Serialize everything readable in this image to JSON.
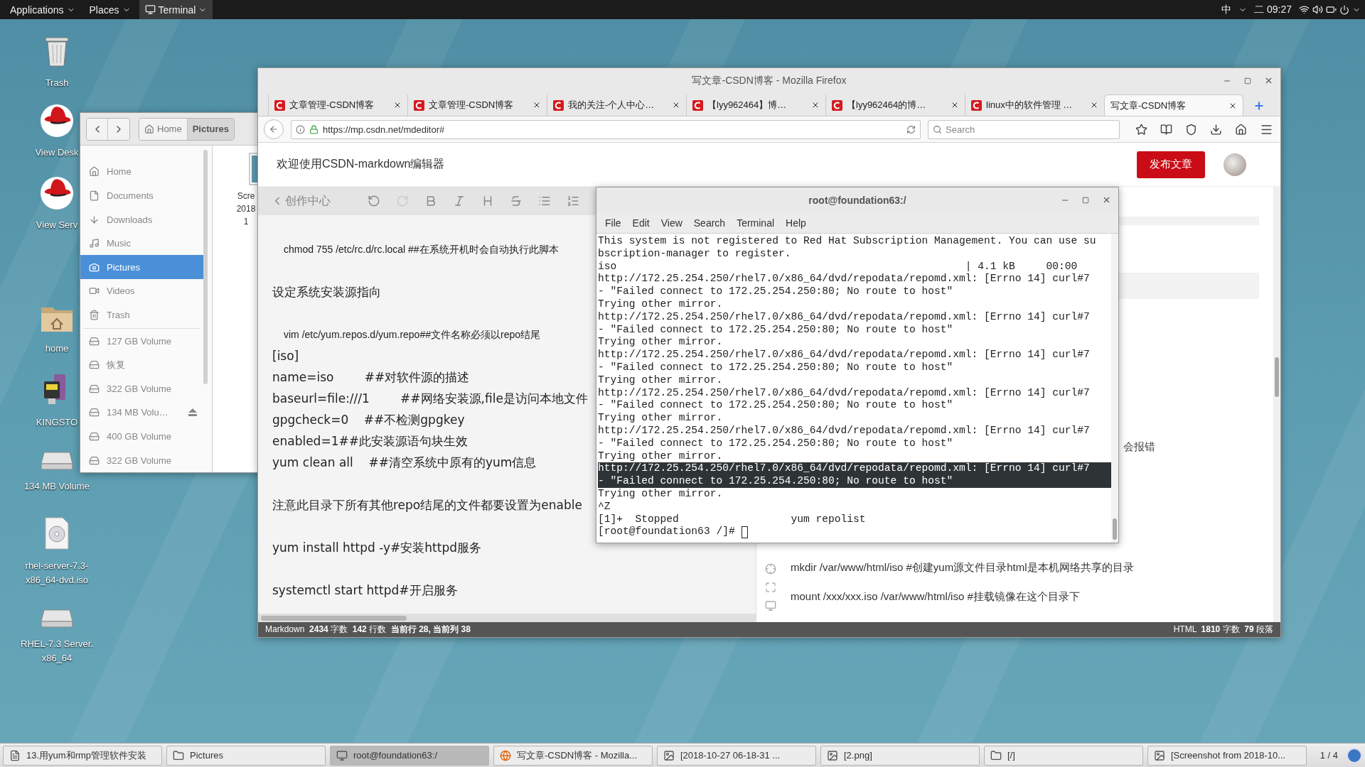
{
  "top_bar": {
    "menus": [
      {
        "label": "Applications",
        "selected": false
      },
      {
        "label": "Places",
        "selected": false
      },
      {
        "label": "Terminal",
        "selected": true
      }
    ],
    "input_method": "中",
    "clock": "二 09:27"
  },
  "desktop_icons": [
    {
      "label": "Trash",
      "kind": "trash"
    },
    {
      "label": "View Desk",
      "kind": "redhat"
    },
    {
      "label": "View Serv",
      "kind": "redhat"
    },
    {
      "label": "home",
      "kind": "folder"
    },
    {
      "label": "KINGSTO",
      "kind": "usb"
    },
    {
      "label": "134 MB Volume",
      "kind": "drive"
    },
    {
      "label": "rhel-server-7.3-x86_64-dvd.iso",
      "kind": "disc"
    },
    {
      "label": "RHEL-7.3 Server. x86_64",
      "kind": "drive"
    }
  ],
  "file_manager": {
    "path": [
      {
        "label": "Home",
        "selected": false
      },
      {
        "label": "Pictures",
        "selected": true
      }
    ],
    "sidebar": [
      {
        "label": "Home",
        "kind": "home",
        "selected": false,
        "ejectable": false
      },
      {
        "label": "Documents",
        "kind": "documents",
        "selected": false,
        "ejectable": false
      },
      {
        "label": "Downloads",
        "kind": "downloads",
        "selected": false,
        "ejectable": false
      },
      {
        "label": "Music",
        "kind": "music",
        "selected": false,
        "ejectable": false
      },
      {
        "label": "Pictures",
        "kind": "pictures",
        "selected": true,
        "ejectable": false
      },
      {
        "label": "Videos",
        "kind": "videos",
        "selected": false,
        "ejectable": false
      },
      {
        "label": "Trash",
        "kind": "trash",
        "selected": false,
        "ejectable": false
      },
      {
        "label": "127 GB Volume",
        "kind": "volume",
        "selected": false,
        "ejectable": false
      },
      {
        "label": "恢复",
        "kind": "volume",
        "selected": false,
        "ejectable": false
      },
      {
        "label": "322 GB Volume",
        "kind": "volume",
        "selected": false,
        "ejectable": false
      },
      {
        "label": "134 MB Volu…",
        "kind": "volume",
        "selected": false,
        "ejectable": true
      },
      {
        "label": "400 GB Volume",
        "kind": "volume",
        "selected": false,
        "ejectable": false
      },
      {
        "label": "322 GB Volume",
        "kind": "volume",
        "selected": false,
        "ejectable": false
      }
    ],
    "file": {
      "label_lines": [
        "Scre",
        "2018",
        "1"
      ]
    }
  },
  "firefox": {
    "title": "写文章-CSDN博客 - Mozilla Firefox",
    "tabs": [
      {
        "label": "文章管理-CSDN博客",
        "selected": false
      },
      {
        "label": "文章管理-CSDN博客",
        "selected": false
      },
      {
        "label": "我的关注-个人中心…",
        "selected": false
      },
      {
        "label": "【lyy962464】博…",
        "selected": false
      },
      {
        "label": "【lyy962464的博…",
        "selected": false
      },
      {
        "label": "linux中的软件管理 …",
        "selected": false
      },
      {
        "label": "写文章-CSDN博客",
        "selected": true
      }
    ],
    "url": "https://mp.csdn.net/mdeditor#",
    "search": {
      "placeholder": "Search"
    },
    "page": {
      "heading": "欢迎使用CSDN-markdown编辑器",
      "publish_button": "发布文章",
      "back_link": "创作中心",
      "editor_lines": [
        {
          "text": "chmod 755 /etc/rc.d/rc.local ##在系统开机时会自动执行此脚本",
          "kind": "code"
        },
        {
          "text": "设定系统安装源指向",
          "kind": "para"
        },
        {
          "text": "vim /etc/yum.repos.d/yum.repo##文件名称必须以repo结尾",
          "kind": "code"
        },
        {
          "text": "[iso]",
          "kind": "line"
        },
        {
          "text": "name=iso        ##对软件源的描述",
          "kind": "line"
        },
        {
          "text": "baseurl=file:///1        ##网络安装源,file是访问本地文件",
          "kind": "line"
        },
        {
          "text": "gpgcheck=0    ##不检测gpgkey",
          "kind": "line"
        },
        {
          "text": "enabled=1##此安装源语句块生效",
          "kind": "line"
        },
        {
          "text": "yum clean all    ##清空系统中原有的yum信息",
          "kind": "line"
        },
        {
          "text": "注意此目录下所有其他repo结尾的文件都要设置为enable",
          "kind": "para"
        },
        {
          "text": "yum install httpd -y#安装httpd服务",
          "kind": "para"
        },
        {
          "text": "systemctl start httpd#开启服务",
          "kind": "para"
        }
      ],
      "preview_tail": "会报错",
      "preview_lines": [
        "mkdir /var/www/html/iso #创建yum源文件目录html是本机网络共享的目录",
        "mount /xxx/xxx.iso /var/www/html/iso #挂载镜像在这个目录下"
      ],
      "status_left": "Markdown  **2434** 字数  **142** 行数  **当前行 28, 当前列 38**",
      "status_right": "HTML  **1810** 字数  **79** 段落"
    }
  },
  "terminal": {
    "title": "root@foundation63:/",
    "menus": [
      "File",
      "Edit",
      "View",
      "Search",
      "Terminal",
      "Help"
    ],
    "lines": [
      {
        "text": "This system is not registered to Red Hat Subscription Management. You can use su",
        "selected": false
      },
      {
        "text": "bscription-manager to register.",
        "selected": false
      },
      {
        "text": "iso                                                        | 4.1 kB     00:00",
        "selected": false
      },
      {
        "text": "http://172.25.254.250/rhel7.0/x86_64/dvd/repodata/repomd.xml: [Errno 14] curl#7",
        "selected": false
      },
      {
        "text": "- \"Failed connect to 172.25.254.250:80; No route to host\"",
        "selected": false
      },
      {
        "text": "Trying other mirror.",
        "selected": false
      },
      {
        "text": "http://172.25.254.250/rhel7.0/x86_64/dvd/repodata/repomd.xml: [Errno 14] curl#7",
        "selected": false
      },
      {
        "text": "- \"Failed connect to 172.25.254.250:80; No route to host\"",
        "selected": false
      },
      {
        "text": "Trying other mirror.",
        "selected": false
      },
      {
        "text": "http://172.25.254.250/rhel7.0/x86_64/dvd/repodata/repomd.xml: [Errno 14] curl#7",
        "selected": false
      },
      {
        "text": "- \"Failed connect to 172.25.254.250:80; No route to host\"",
        "selected": false
      },
      {
        "text": "Trying other mirror.",
        "selected": false
      },
      {
        "text": "http://172.25.254.250/rhel7.0/x86_64/dvd/repodata/repomd.xml: [Errno 14] curl#7",
        "selected": false
      },
      {
        "text": "- \"Failed connect to 172.25.254.250:80; No route to host\"",
        "selected": false
      },
      {
        "text": "Trying other mirror.",
        "selected": false
      },
      {
        "text": "http://172.25.254.250/rhel7.0/x86_64/dvd/repodata/repomd.xml: [Errno 14] curl#7",
        "selected": false
      },
      {
        "text": "- \"Failed connect to 172.25.254.250:80; No route to host\"",
        "selected": false
      },
      {
        "text": "Trying other mirror.",
        "selected": false
      },
      {
        "text": "http://172.25.254.250/rhel7.0/x86_64/dvd/repodata/repomd.xml: [Errno 14] curl#7",
        "selected": true
      },
      {
        "text": "- \"Failed connect to 172.25.254.250:80; No route to host\"",
        "selected": true
      },
      {
        "text": "Trying other mirror.",
        "selected": false
      },
      {
        "text": "^Z",
        "selected": false
      },
      {
        "text": "[1]+  Stopped                  yum repolist",
        "selected": false
      }
    ],
    "prompt": "[root@foundation63 /]#"
  },
  "taskbar": {
    "items": [
      {
        "label": "13.用yum和rmp管理软件安装",
        "kind": "document",
        "selected": false
      },
      {
        "label": "Pictures",
        "kind": "folder",
        "selected": false
      },
      {
        "label": "root@foundation63:/",
        "kind": "terminal",
        "selected": true
      },
      {
        "label": "写文章-CSDN博客 - Mozilla...",
        "kind": "browser",
        "selected": false
      },
      {
        "label": "[2018-10-27 06-18-31 ...",
        "kind": "viewer",
        "selected": false
      },
      {
        "label": "[2.png]",
        "kind": "viewer",
        "selected": false
      },
      {
        "label": "[/]",
        "kind": "folder",
        "selected": false
      },
      {
        "label": "[Screenshot from 2018-10...",
        "kind": "viewer",
        "selected": false
      }
    ],
    "pager": "1 / 4"
  }
}
